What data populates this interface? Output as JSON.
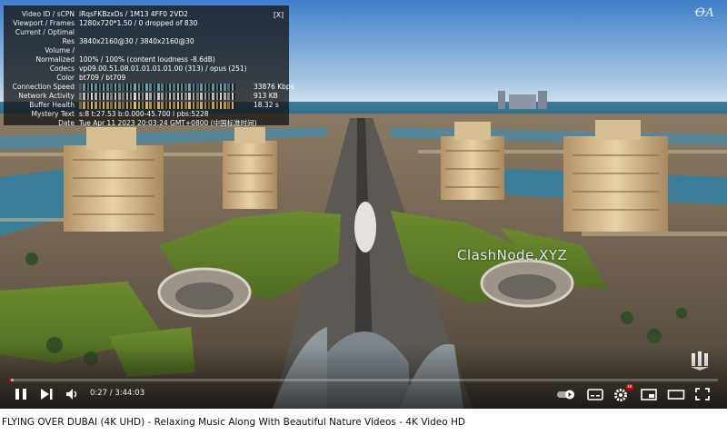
{
  "stats": {
    "close_label": "[X]",
    "rows": [
      {
        "key": "Video ID / sCPN",
        "value": "iRqsFKBzxDs / 1M13 4FF0 2VD2"
      },
      {
        "key": "Viewport / Frames",
        "value": "1280x720*1.50 / 0 dropped of 830"
      },
      {
        "key": "Current / Optimal",
        "value": ""
      },
      {
        "key": "Res",
        "value": "3840x2160@30 / 3840x2160@30"
      },
      {
        "key": "Volume /",
        "value": ""
      },
      {
        "key": "Normalized",
        "value": "100% / 100% (content loudness -8.6dB)"
      },
      {
        "key": "Codecs",
        "value": "vp09.00.51.08.01.01.01.01.00 (313) / opus (251)"
      },
      {
        "key": "Color",
        "value": "bt709 / bt709"
      },
      {
        "key": "Connection Speed",
        "graph": true,
        "graph_color": "#6fb1c5",
        "right_value": "33876 Kbps"
      },
      {
        "key": "Network Activity",
        "graph": true,
        "graph_color": "#e0e0e0",
        "right_value": "913 KB"
      },
      {
        "key": "Buffer Health",
        "graph": true,
        "graph_color": "#e9c46a",
        "right_value": "18.32 s"
      },
      {
        "key": "Mystery Text",
        "value": "s:8 t:27.53 b:0.000-45.700 l pbs:5228"
      },
      {
        "key": "Date",
        "value": "Tue Apr 11 2023 20:03:24 GMT+0800 (中国标准时间)"
      }
    ]
  },
  "overlay": {
    "watermark": "ClashNode.XYZ",
    "channel_logo_text": "ꝊA"
  },
  "controls": {
    "time_display": "0:27 / 3:44:03",
    "played_fraction": 0.002,
    "buffered_fraction": 0.006,
    "hd_badge": "4K",
    "buttons": [
      "play-pause",
      "next",
      "volume",
      "autoplay",
      "subtitles",
      "settings",
      "miniplayer",
      "theater",
      "fullscreen"
    ],
    "accent_color": "#ff0000"
  },
  "video": {
    "title": "FLYING OVER DUBAI (4K UHD) - Relaxing Music Along With Beautiful Nature Videos - 4K Video HD"
  }
}
